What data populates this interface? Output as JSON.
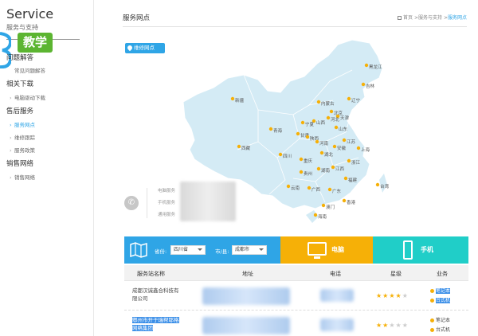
{
  "sidebar": {
    "title": "Service",
    "subtitle": "服务与支持",
    "badge": "教学",
    "sections": [
      {
        "label": "问题解答",
        "items": [
          {
            "label": "常见问题解答",
            "active": false
          }
        ]
      },
      {
        "label": "相关下载",
        "items": [
          {
            "label": "电脑驱动下载",
            "active": false
          }
        ]
      },
      {
        "label": "售后服务",
        "items": [
          {
            "label": "服务网点",
            "active": true
          },
          {
            "label": "维修跟踪",
            "active": false
          },
          {
            "label": "服务政策",
            "active": false
          }
        ]
      },
      {
        "label": "销售网络",
        "items": [
          {
            "label": "销售网络",
            "active": false
          }
        ]
      }
    ]
  },
  "main": {
    "title": "服务网点",
    "breadcrumb": {
      "home": "首页",
      "sep1": ">",
      "level1": "服务与支持",
      "sep2": ">",
      "current": "服务网点"
    },
    "tag": "维修网点"
  },
  "map": {
    "provinces": [
      "黑龙江",
      "吉林",
      "辽宁",
      "内蒙古",
      "北京",
      "天津",
      "河北",
      "山西",
      "山东",
      "新疆",
      "青海",
      "宁夏",
      "甘肃",
      "陕西",
      "河南",
      "江苏",
      "安徽",
      "上海",
      "西藏",
      "四川",
      "重庆",
      "湖北",
      "浙江",
      "贵州",
      "湖南",
      "江西",
      "福建",
      "云南",
      "广西",
      "广东",
      "台湾",
      "澳门",
      "香港",
      "海南"
    ]
  },
  "contact": {
    "lines": [
      "电脑服务",
      "手机服务",
      "通用服务"
    ]
  },
  "filter": {
    "province_label": "省份:",
    "province_value": "四川省",
    "city_label": "市/县:",
    "city_value": "成都市",
    "cat_computer": "电脑",
    "cat_phone": "手机",
    "colors": {
      "blue": "#2fa5e6",
      "yellow": "#f6b007",
      "teal": "#20cec8"
    }
  },
  "table": {
    "headers": {
      "name": "服务站名称",
      "address": "地址",
      "phone": "电话",
      "level": "星级",
      "business": "业务"
    },
    "rows": [
      {
        "name_line1": "成都汉诚鑫合科技有",
        "name_line2": "限公司",
        "selected": false,
        "stars": 4,
        "biz": [
          "笔记本",
          "台式机"
        ],
        "biz_selected": true
      },
      {
        "name_line1": "郫州市开于瑞帮耶格",
        "name_line2": "网络集团",
        "selected": true,
        "stars": 2,
        "biz": [
          "笔记本",
          "台式机"
        ],
        "biz_selected": false
      }
    ]
  }
}
